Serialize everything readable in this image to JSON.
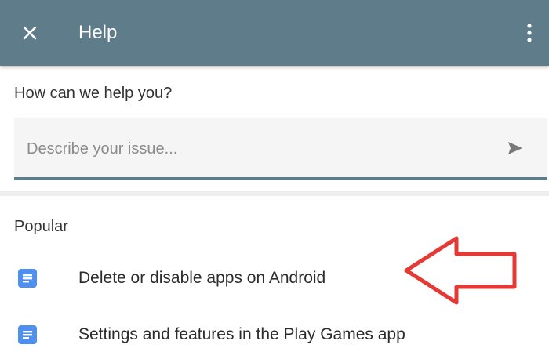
{
  "app_bar": {
    "title": "Help",
    "close_icon": "close-icon",
    "more_icon": "more-vertical-icon",
    "background": "#5f7c8b"
  },
  "search": {
    "heading": "How can we help you?",
    "placeholder": "Describe your issue...",
    "value": "",
    "send_icon": "send-icon"
  },
  "popular": {
    "label": "Popular",
    "items": [
      {
        "icon": "article-icon",
        "label": "Delete or disable apps on Android"
      },
      {
        "icon": "article-icon",
        "label": "Settings and features in the Play Games app"
      }
    ]
  },
  "annotation": {
    "icon": "left-arrow-outline-icon",
    "color": "#e53935"
  },
  "colors": {
    "accent_blue": "#4f8ff0",
    "text": "#333333"
  }
}
